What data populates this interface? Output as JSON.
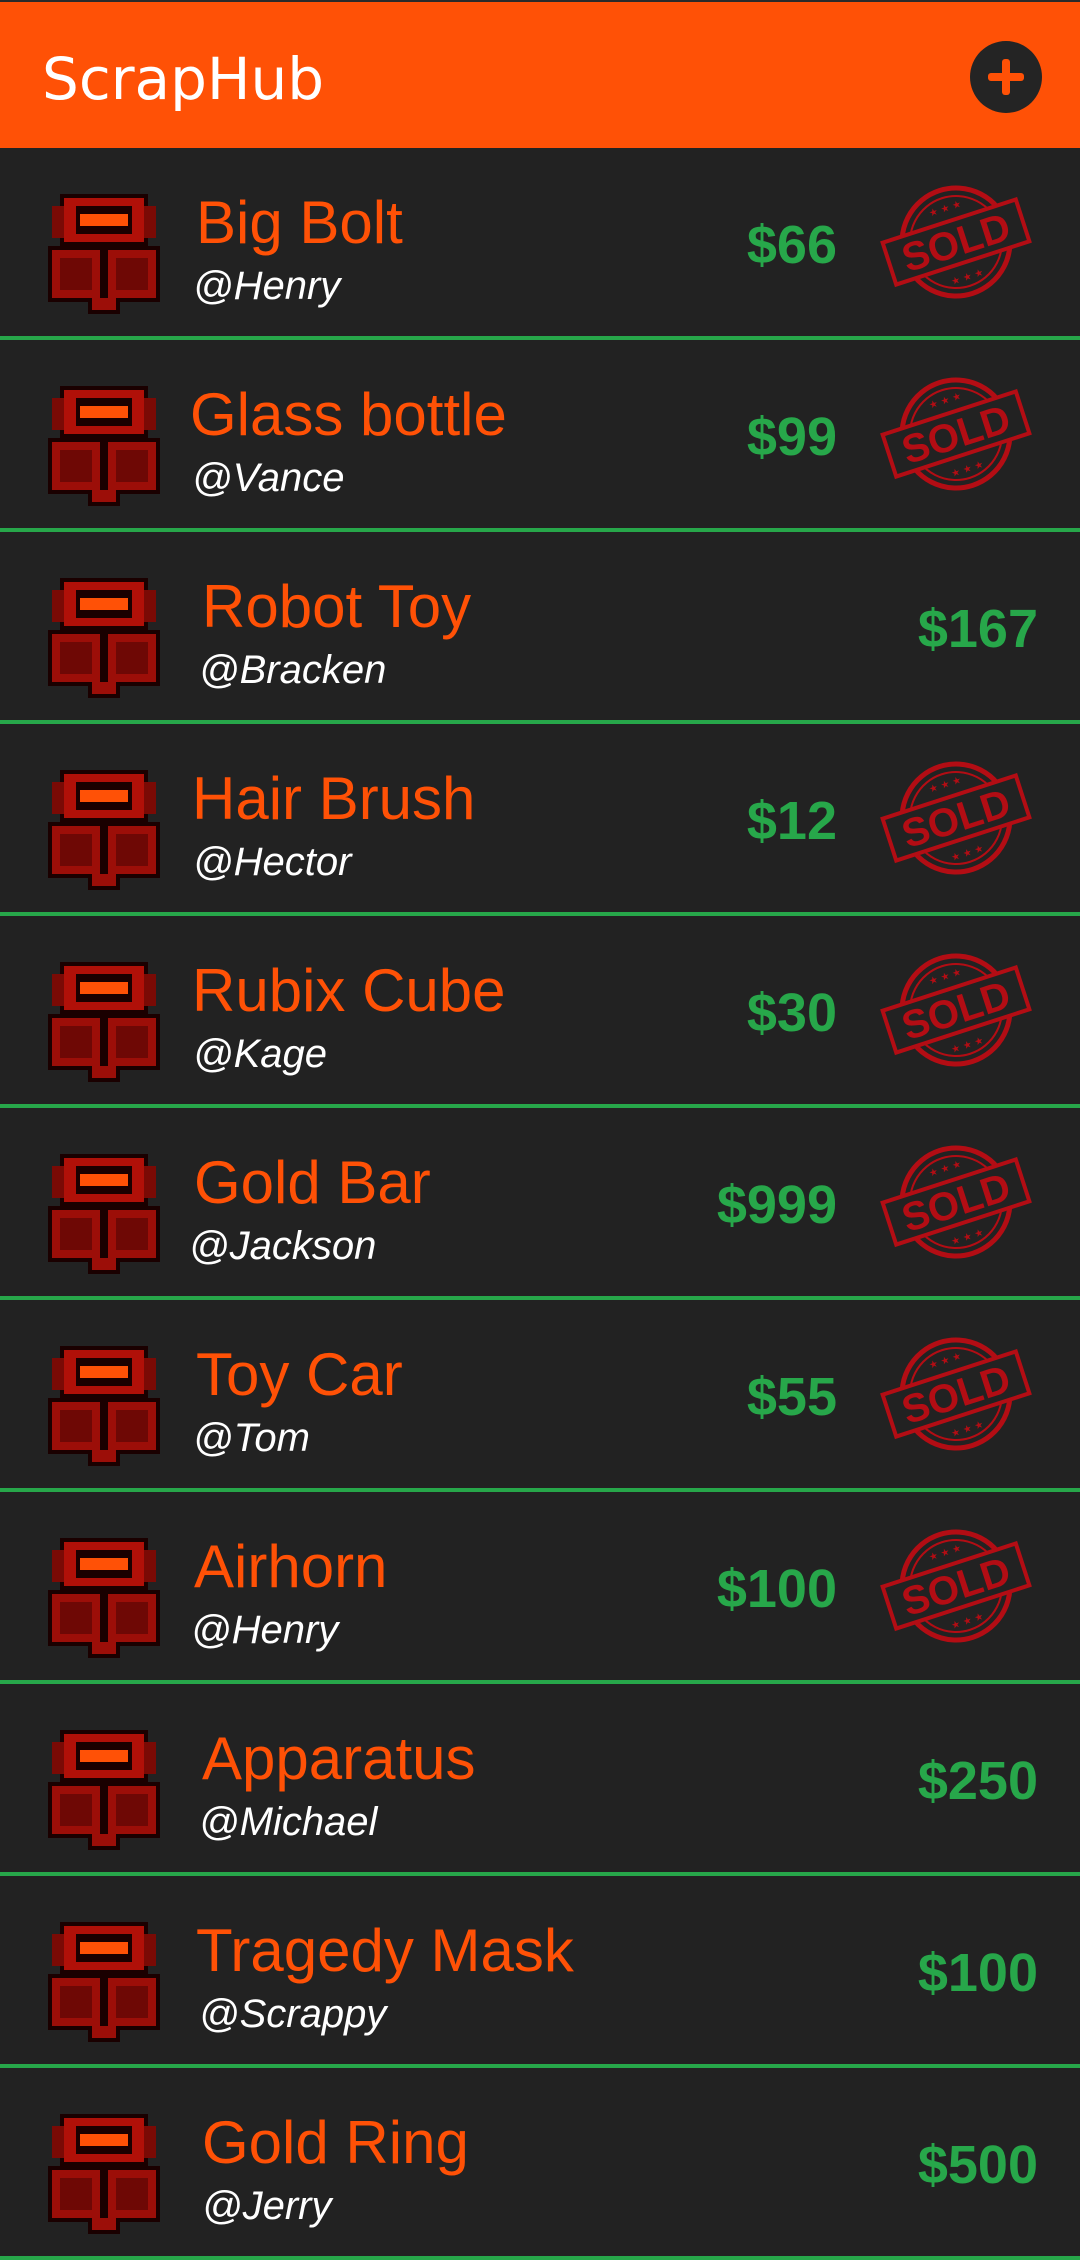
{
  "app": {
    "title": "ScrapHub",
    "brand_color": "#FF5106",
    "price_color": "#27A74A",
    "add_icon": "plus-circle-icon"
  },
  "listings": [
    {
      "title": "Big Bolt",
      "user": "@Henry",
      "price": "$66",
      "sold": true,
      "sold_label": "SOLD"
    },
    {
      "title": "Glass bottle",
      "user": "@Vance",
      "price": "$99",
      "sold": true,
      "sold_label": "SOLD"
    },
    {
      "title": "Robot Toy",
      "user": "@Bracken",
      "price": "$167",
      "sold": false
    },
    {
      "title": "Hair Brush",
      "user": "@Hector",
      "price": "$12",
      "sold": true,
      "sold_label": "SOLD"
    },
    {
      "title": "Rubix Cube",
      "user": "@Kage",
      "price": "$30",
      "sold": true,
      "sold_label": "SOLD"
    },
    {
      "title": "Gold Bar",
      "user": "@Jackson",
      "price": "$999",
      "sold": true,
      "sold_label": "SOLD"
    },
    {
      "title": "Toy Car",
      "user": "@Tom",
      "price": "$55",
      "sold": true,
      "sold_label": "SOLD"
    },
    {
      "title": "Airhorn",
      "user": "@Henry",
      "price": "$100",
      "sold": true,
      "sold_label": "SOLD"
    },
    {
      "title": "Apparatus",
      "user": "@Michael",
      "price": "$250",
      "sold": false
    },
    {
      "title": "Tragedy Mask",
      "user": "@Scrappy",
      "price": "$100",
      "sold": false
    },
    {
      "title": "Gold Ring",
      "user": "@Jerry",
      "price": "$500",
      "sold": false
    }
  ]
}
